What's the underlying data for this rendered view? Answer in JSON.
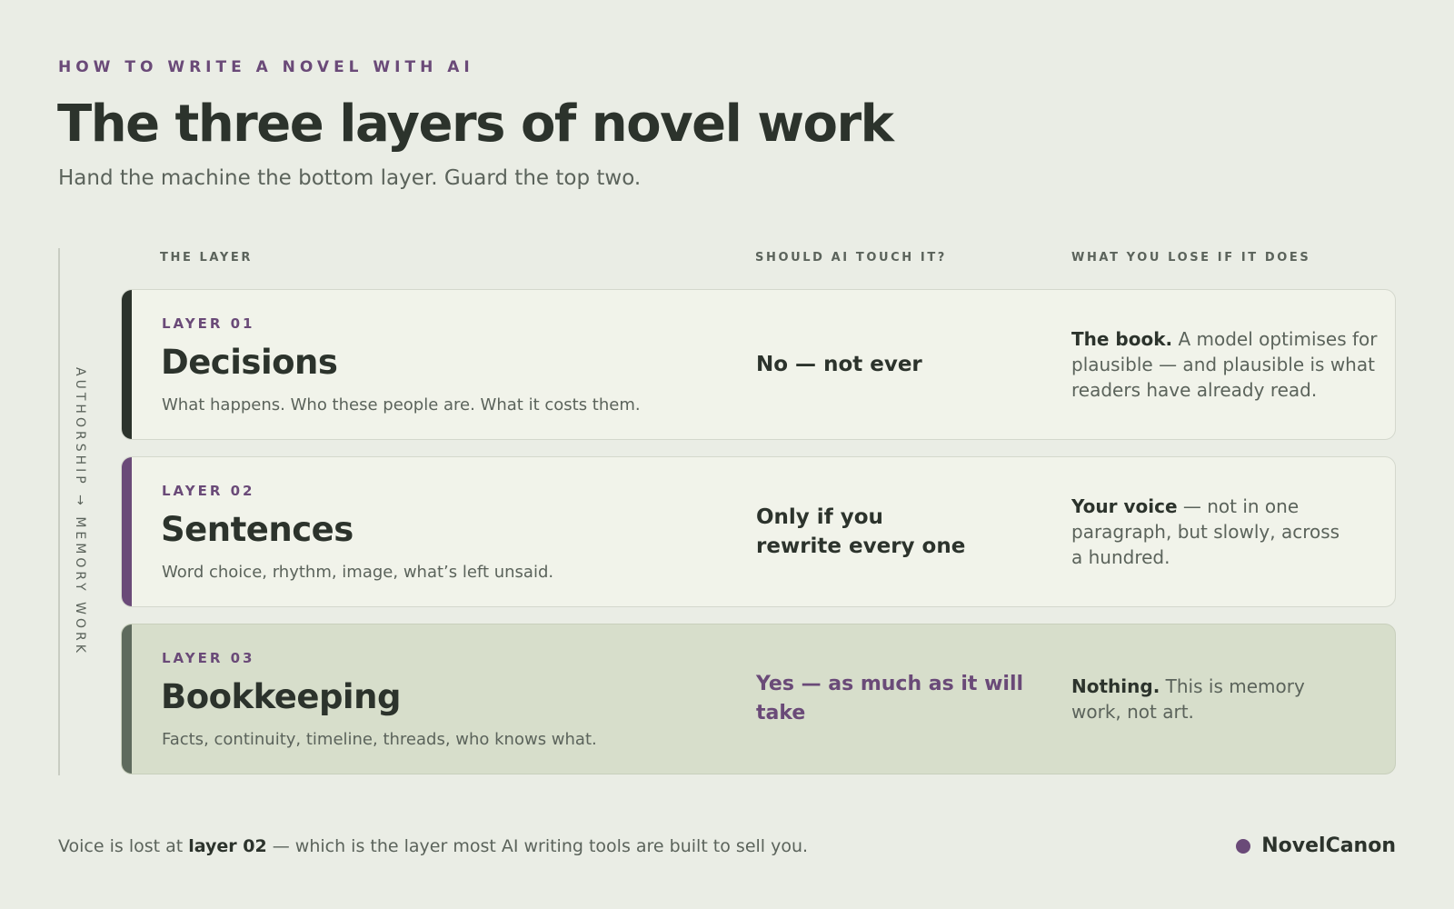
{
  "header": {
    "kicker": "HOW TO WRITE A NOVEL WITH AI",
    "title": "The three layers of novel work",
    "subtitle": "Hand the machine the bottom layer. Guard the top two."
  },
  "axis_label": "AUTHORSHIP → MEMORY WORK",
  "columns": {
    "layer": "THE LAYER",
    "touch": "SHOULD AI TOUCH IT?",
    "lose": "WHAT YOU LOSE IF IT DOES"
  },
  "rows": [
    {
      "number": "LAYER 01",
      "name": "Decisions",
      "desc": "What happens. Who these people are. What it costs them.",
      "touch": "No — not ever",
      "lose_bold": "The book.",
      "lose_rest": " A model optimises for plausible — and plausible is what readers have already read.",
      "bar_color": "#2c332c"
    },
    {
      "number": "LAYER 02",
      "name": "Sentences",
      "desc": "Word choice, rhythm, image, what’s left unsaid.",
      "touch": "Only if you rewrite every one",
      "lose_bold": "Your voice",
      "lose_rest": " — not in one paragraph, but slowly, across a hundred.",
      "bar_color": "#6a4a78"
    },
    {
      "number": "LAYER 03",
      "name": "Bookkeeping",
      "desc": "Facts, continuity, timeline, threads, who knows what.",
      "touch": "Yes — as much as it will take",
      "lose_bold": "Nothing.",
      "lose_rest": " This is memory work, not art.",
      "bar_color": "#5e6a5d"
    }
  ],
  "footer": {
    "prefix": "Voice is lost at ",
    "highlight": "layer 02",
    "suffix": " — which is the layer most AI writing tools are built to sell you.",
    "brand": "NovelCanon"
  },
  "colors": {
    "accent": "#6a4a78",
    "background": "#eaede5",
    "text": "#2c332c"
  }
}
